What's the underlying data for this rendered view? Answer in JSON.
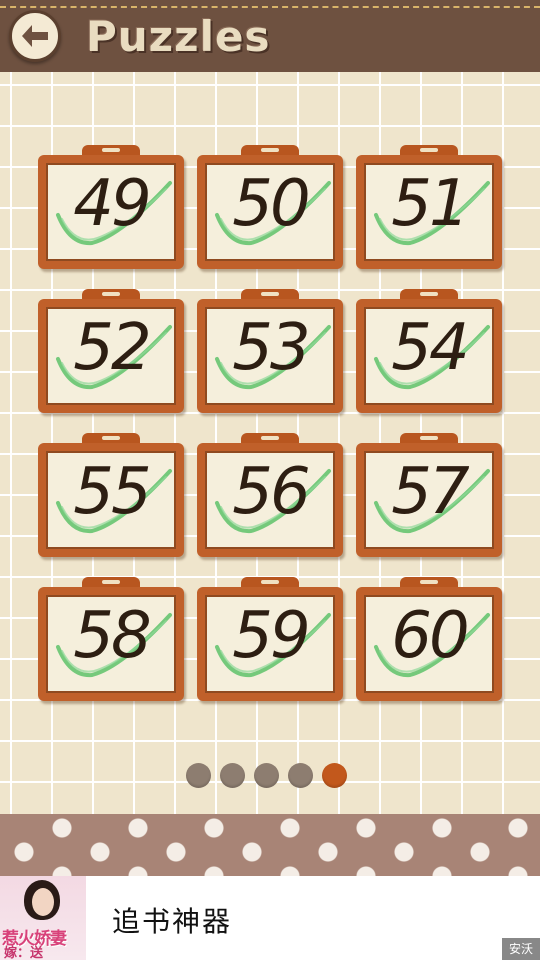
{
  "header": {
    "title": "Puzzles",
    "back_icon": "back-arrow-icon"
  },
  "puzzles": [
    {
      "number": "49",
      "completed": true
    },
    {
      "number": "50",
      "completed": true
    },
    {
      "number": "51",
      "completed": true
    },
    {
      "number": "52",
      "completed": true
    },
    {
      "number": "53",
      "completed": true
    },
    {
      "number": "54",
      "completed": true
    },
    {
      "number": "55",
      "completed": true
    },
    {
      "number": "56",
      "completed": true
    },
    {
      "number": "57",
      "completed": true
    },
    {
      "number": "58",
      "completed": true
    },
    {
      "number": "59",
      "completed": true
    },
    {
      "number": "60",
      "completed": true
    }
  ],
  "pagination": {
    "pages": 5,
    "current": 5
  },
  "ad": {
    "title": "追书神器",
    "thumb_line1": "惹火娇妻",
    "thumb_line2": "嫁：送",
    "badge": "安沃"
  },
  "colors": {
    "header": "#6e5140",
    "frame": "#c0602a",
    "check": "#5ec26a",
    "active_dot": "#c2581c",
    "dot": "#8d7d70"
  }
}
